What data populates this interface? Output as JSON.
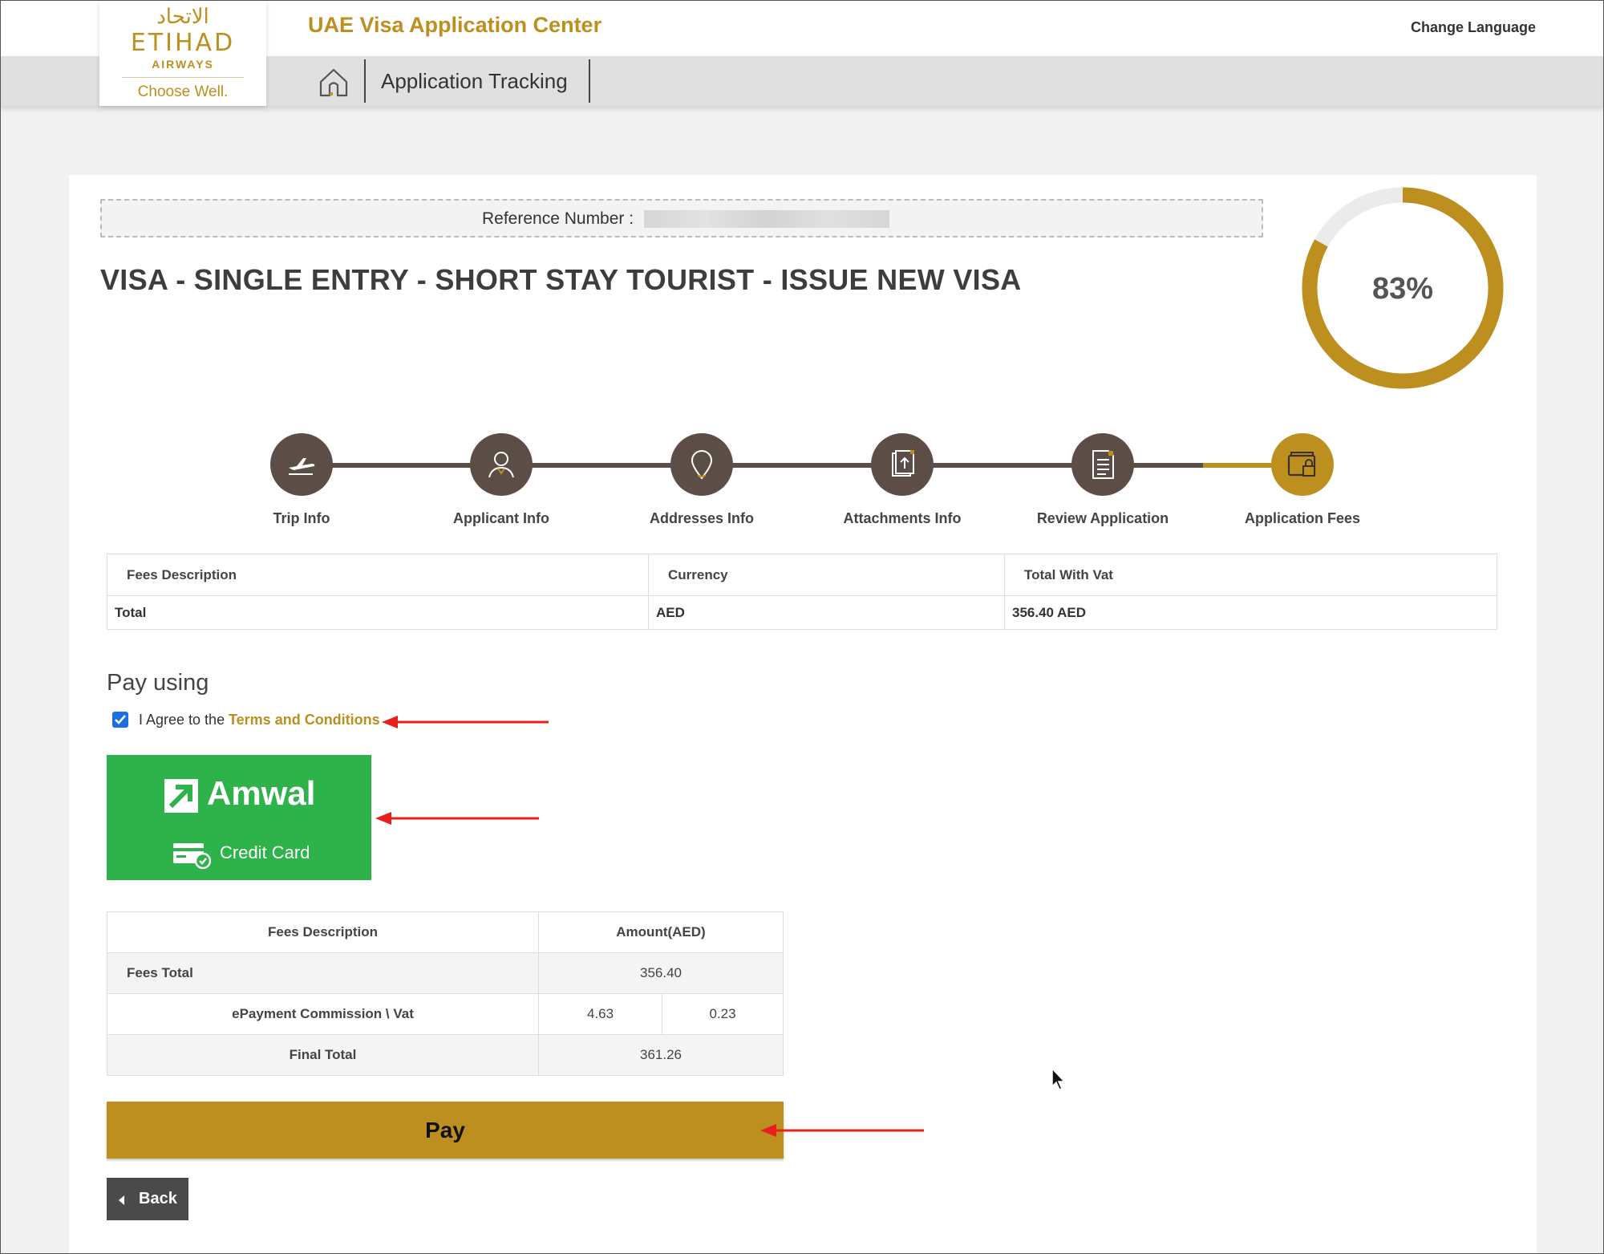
{
  "header": {
    "logo": {
      "arabic": "الاتحاد",
      "brand": "ETIHAD",
      "sub": "AIRWAYS",
      "tagline": "Choose Well."
    },
    "site_title": "UAE Visa Application Center",
    "change_language": "Change Language",
    "nav_label": "Application Tracking"
  },
  "application": {
    "reference_label": "Reference Number :",
    "title": "VISA - SINGLE ENTRY - SHORT STAY TOURIST - ISSUE NEW VISA",
    "progress": 83,
    "progress_text": "83%"
  },
  "steps": [
    {
      "label": "Trip Info",
      "icon": "plane-icon",
      "state": "done"
    },
    {
      "label": "Applicant Info",
      "icon": "person-icon",
      "state": "done"
    },
    {
      "label": "Addresses Info",
      "icon": "location-pin-icon",
      "state": "done"
    },
    {
      "label": "Attachments Info",
      "icon": "upload-document-icon",
      "state": "done"
    },
    {
      "label": "Review Application",
      "icon": "document-list-icon",
      "state": "done"
    },
    {
      "label": "Application Fees",
      "icon": "wallet-lock-icon",
      "state": "active"
    }
  ],
  "fees_table": {
    "headers": [
      "Fees Description",
      "Currency",
      "Total With Vat"
    ],
    "row": [
      "Total",
      "AED",
      "356.40 AED"
    ]
  },
  "payment": {
    "pay_using": "Pay using",
    "agree_prefix": "I Agree to the",
    "agree_link": "Terms and Conditions",
    "agree_checked": true,
    "amwal_label": "Amwal",
    "credit_card_label": "Credit Card"
  },
  "summary_table": {
    "headers": [
      "Fees Description",
      "Amount(AED)"
    ],
    "fees_total_label": "Fees Total",
    "fees_total_value": "356.40",
    "commission_label": "ePayment Commission \\ Vat",
    "commission_value": "4.63",
    "vat_value": "0.23",
    "final_total_label": "Final Total",
    "final_total_value": "361.26"
  },
  "buttons": {
    "pay": "Pay",
    "back": "Back"
  },
  "colors": {
    "gold": "#bd8f1e",
    "step_dark": "#5c4e47",
    "amwal_green": "#2db34a",
    "annotation_red": "#e8201b"
  }
}
